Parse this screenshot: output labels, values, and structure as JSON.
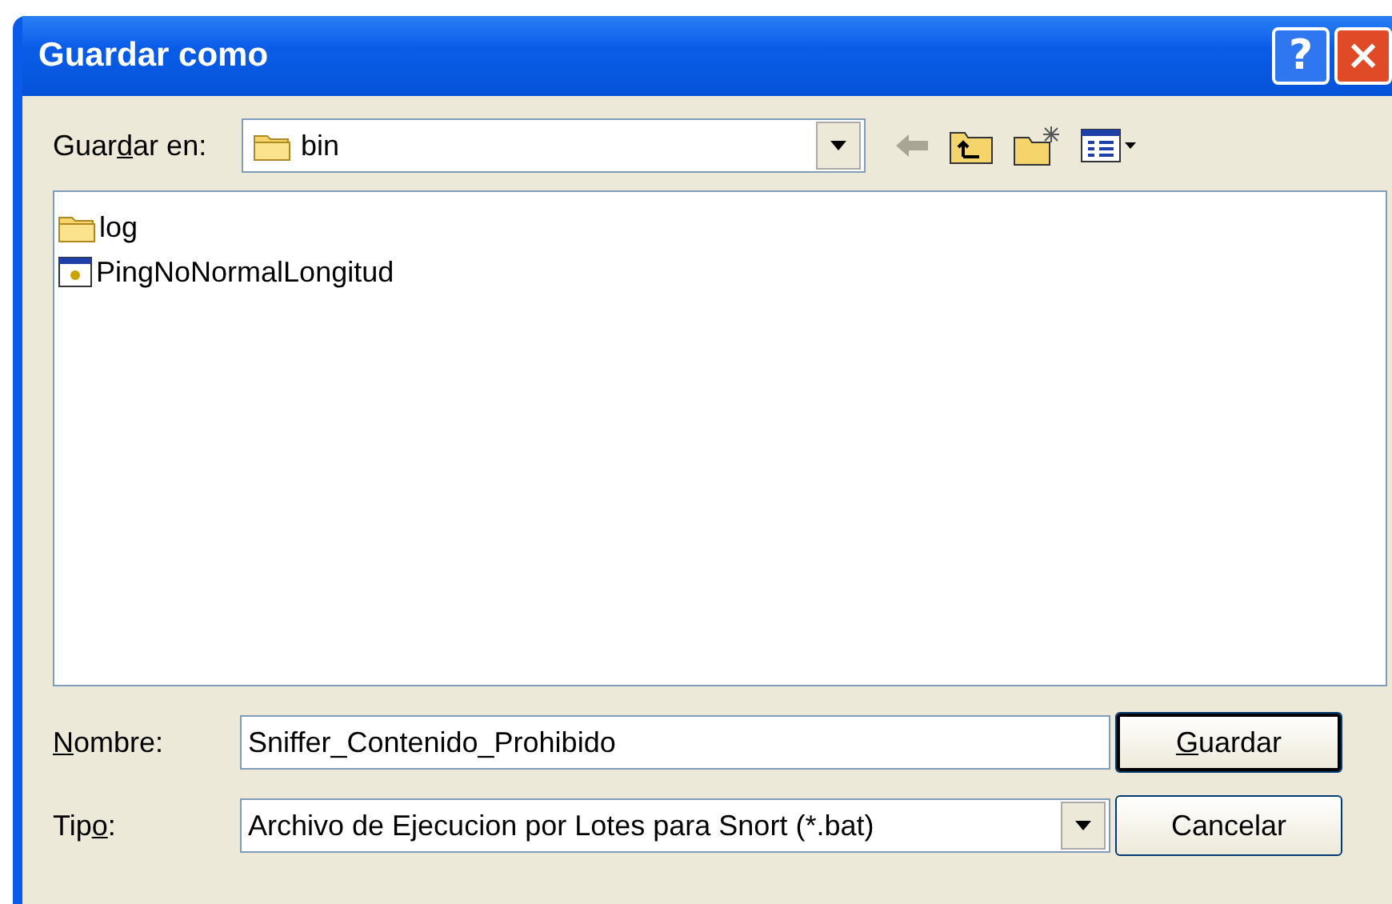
{
  "window": {
    "title": "Guardar como",
    "buttons": [
      "?",
      "×"
    ]
  },
  "location": {
    "label_parts": [
      {
        "text": "Guar",
        "underlined": false
      },
      {
        "text": "d",
        "underlined": true
      },
      {
        "text": "ar en:",
        "underlined": false
      }
    ],
    "value": "bin"
  },
  "files": [
    {
      "kind": "folder",
      "name": "log",
      "selected": false
    },
    {
      "kind": "program",
      "name": "PingNoNormalLongitud",
      "selected": false
    }
  ],
  "name_field": {
    "label_parts": [
      {
        "text": "N",
        "underlined": true
      },
      {
        "text": "ombre:",
        "underlined": false
      }
    ],
    "value": "Sniffer_Contenido_Prohibido"
  },
  "type_field": {
    "label_parts": [
      {
        "text": "Tip",
        "underlined": false
      },
      {
        "text": "o",
        "underlined": true
      },
      {
        "text": ":",
        "underlined": false
      }
    ],
    "value": "Archivo de Ejecucion por Lotes para Snort (*.bat)"
  },
  "actions": [
    {
      "label_parts": [
        {
          "text": "G",
          "underlined": true
        },
        {
          "text": "uardar",
          "underlined": false
        }
      ],
      "default": true
    },
    {
      "label_parts": [
        {
          "text": "Cancelar",
          "underlined": false
        }
      ],
      "default": false
    }
  ]
}
